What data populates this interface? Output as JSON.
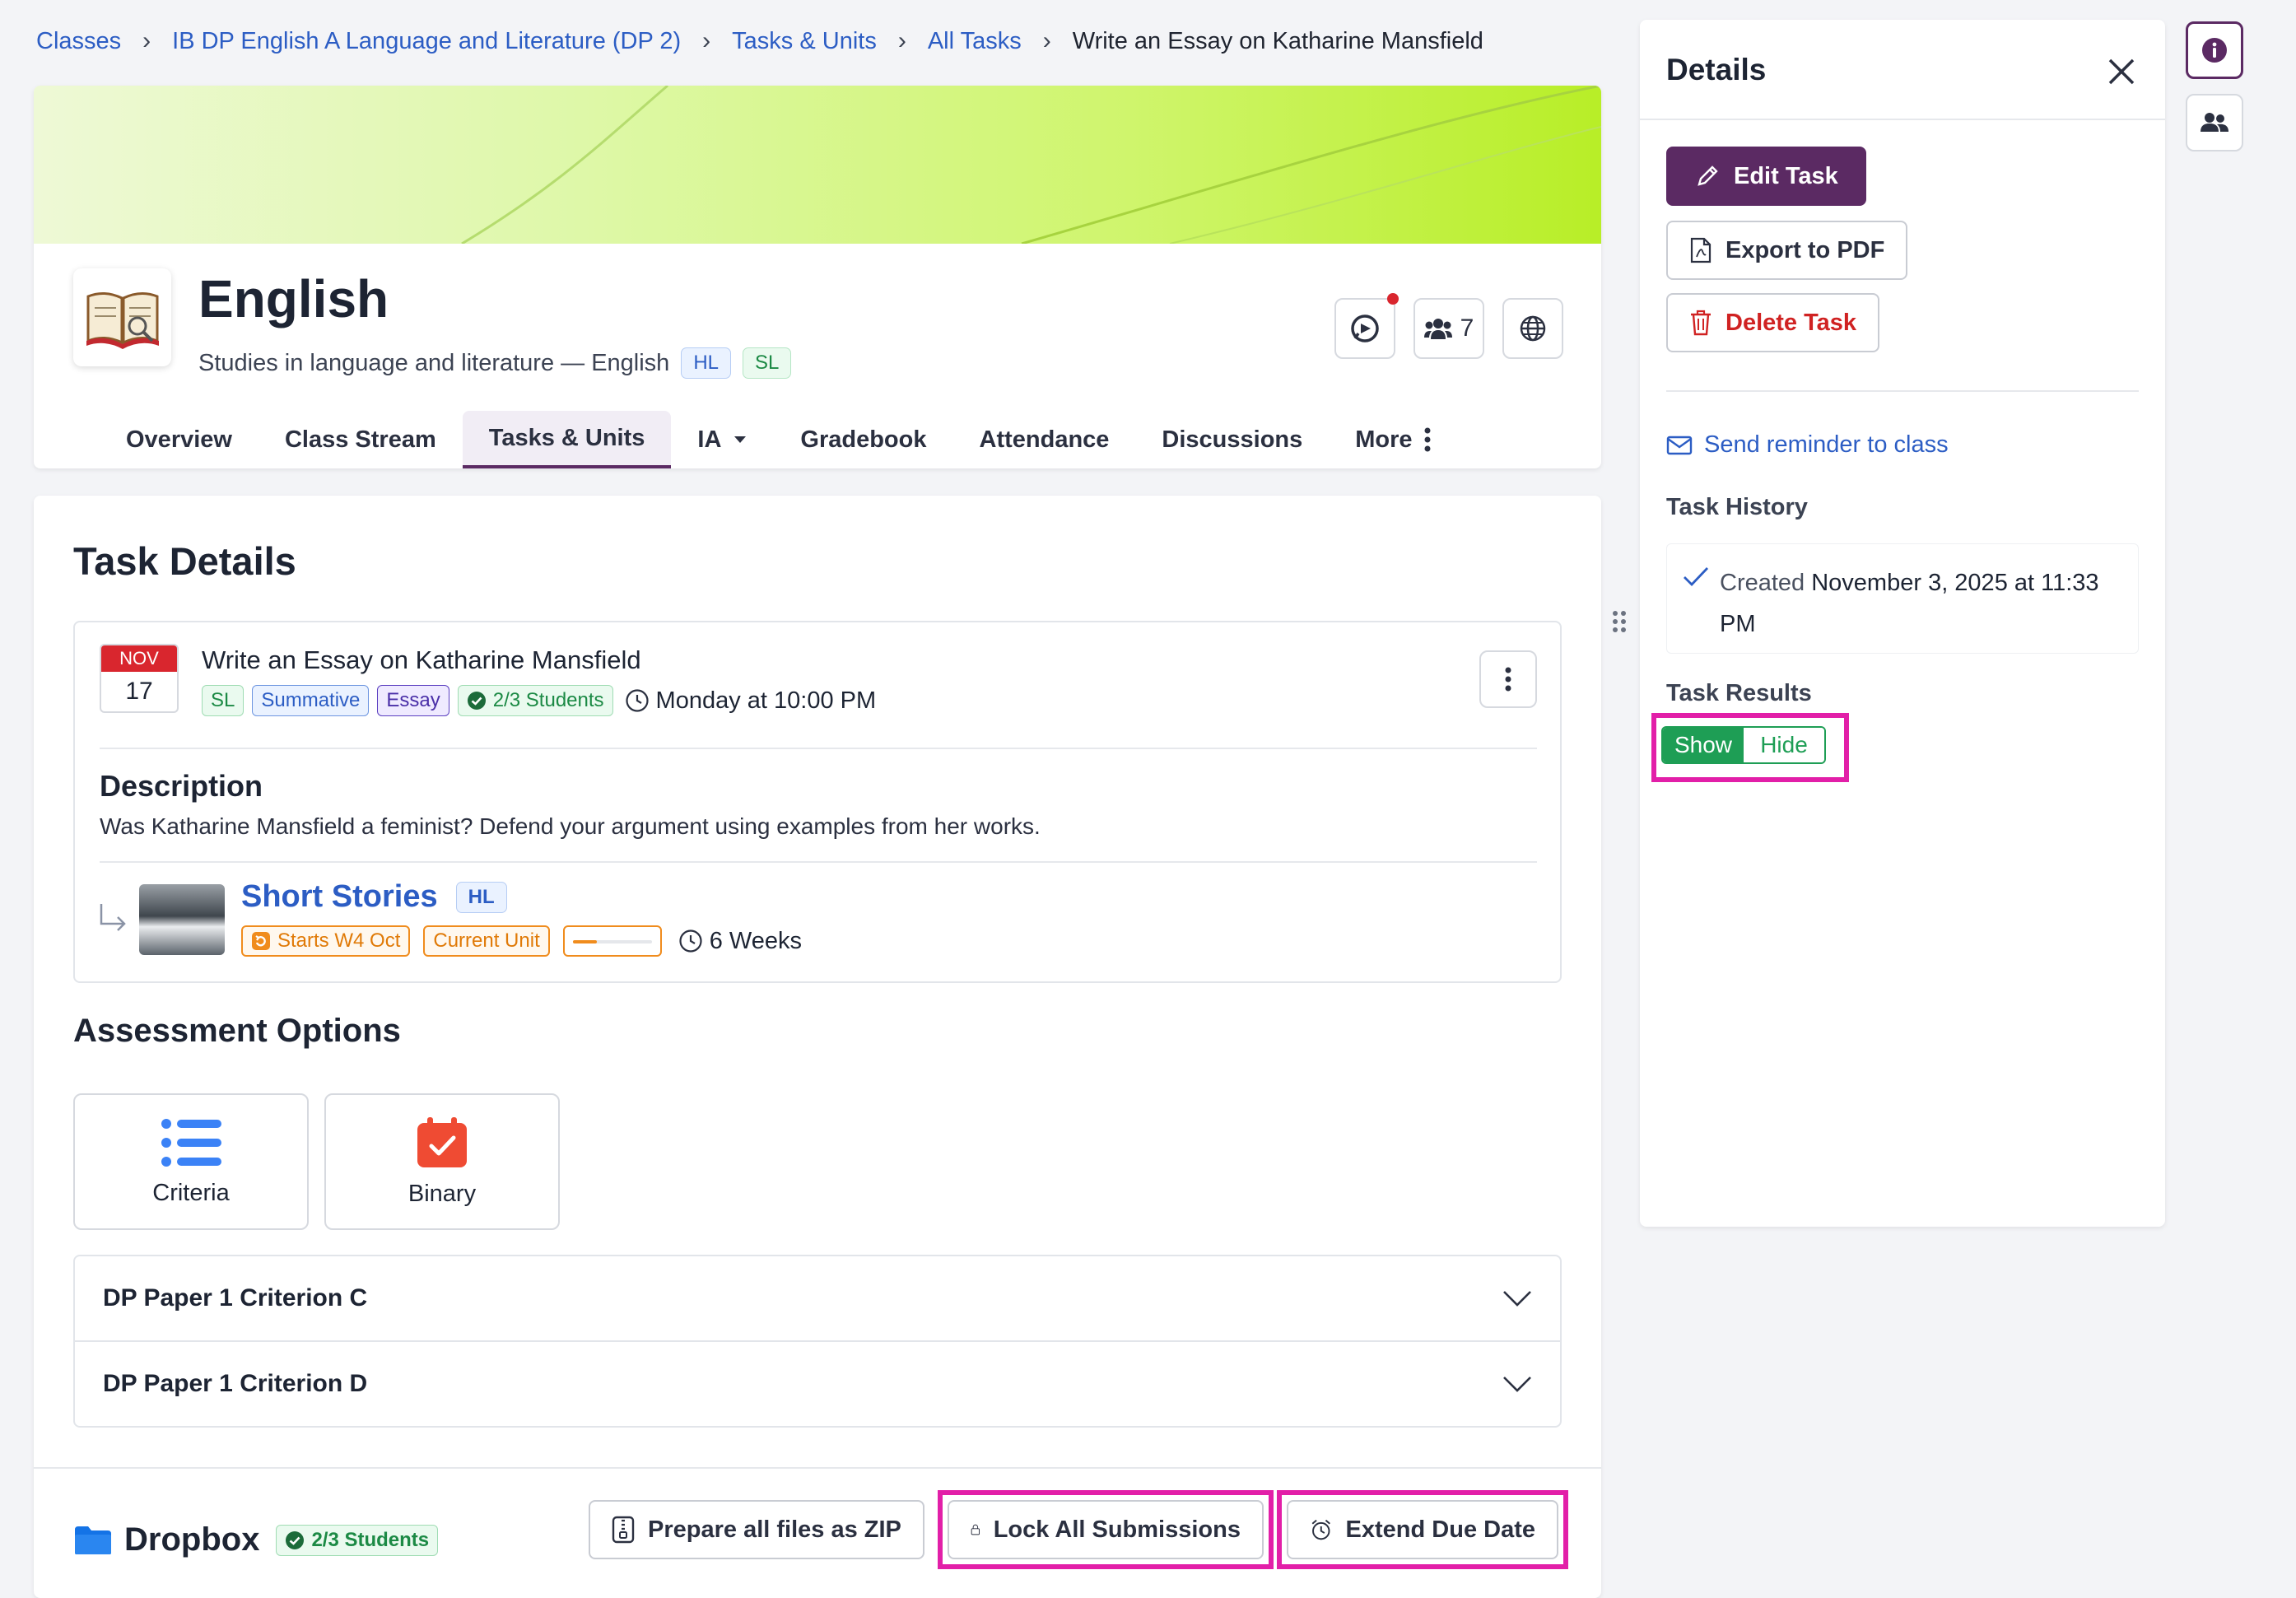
{
  "breadcrumb": {
    "items": [
      "Classes",
      "IB DP English A Language and Literature (DP 2)",
      "Tasks & Units",
      "All Tasks"
    ],
    "current": "Write an Essay on Katharine Mansfield"
  },
  "class": {
    "title": "English",
    "subtitle": "Studies in language and literature — English",
    "levels": [
      "HL",
      "SL"
    ],
    "members_count": "7"
  },
  "tabs": [
    {
      "label": "Overview"
    },
    {
      "label": "Class Stream"
    },
    {
      "label": "Tasks & Units"
    },
    {
      "label": "IA"
    },
    {
      "label": "Gradebook"
    },
    {
      "label": "Attendance"
    },
    {
      "label": "Discussions"
    },
    {
      "label": "More"
    }
  ],
  "task": {
    "section_title": "Task Details",
    "date_month": "NOV",
    "date_day": "17",
    "title": "Write an Essay on Katharine Mansfield",
    "tags": {
      "level": "SL",
      "type": "Summative",
      "category": "Essay",
      "students": "2/3 Students"
    },
    "due": "Monday at 10:00 PM",
    "description_heading": "Description",
    "description": "Was Katharine Mansfield a feminist? Defend your argument using examples from her works."
  },
  "unit": {
    "title": "Short Stories",
    "level": "HL",
    "starts": "Starts W4 Oct",
    "status": "Current Unit",
    "progress": 0.3,
    "duration": "6 Weeks"
  },
  "assessment": {
    "title": "Assessment Options",
    "options": [
      "Criteria",
      "Binary"
    ],
    "criteria": [
      "DP Paper 1 Criterion C",
      "DP Paper 1 Criterion D"
    ]
  },
  "dropbox": {
    "title": "Dropbox",
    "students": "2/3 Students",
    "zip_label": "Prepare all files as ZIP",
    "lock_label": "Lock All Submissions",
    "extend_label": "Extend Due Date"
  },
  "details": {
    "title": "Details",
    "edit_label": "Edit Task",
    "export_label": "Export to PDF",
    "delete_label": "Delete Task",
    "reminder_label": "Send reminder to class",
    "history_title": "Task History",
    "history_prefix": "Created",
    "history_date": "November 3, 2025 at 11:33 PM",
    "results_title": "Task Results",
    "toggle_on": "Show",
    "toggle_off": "Hide"
  },
  "colors": {
    "brand": "#5b2a63",
    "link": "#2c5dc4",
    "highlight": "#e21fa8",
    "success": "#1e9e55",
    "danger": "#d02222",
    "warning": "#f08c1d"
  }
}
